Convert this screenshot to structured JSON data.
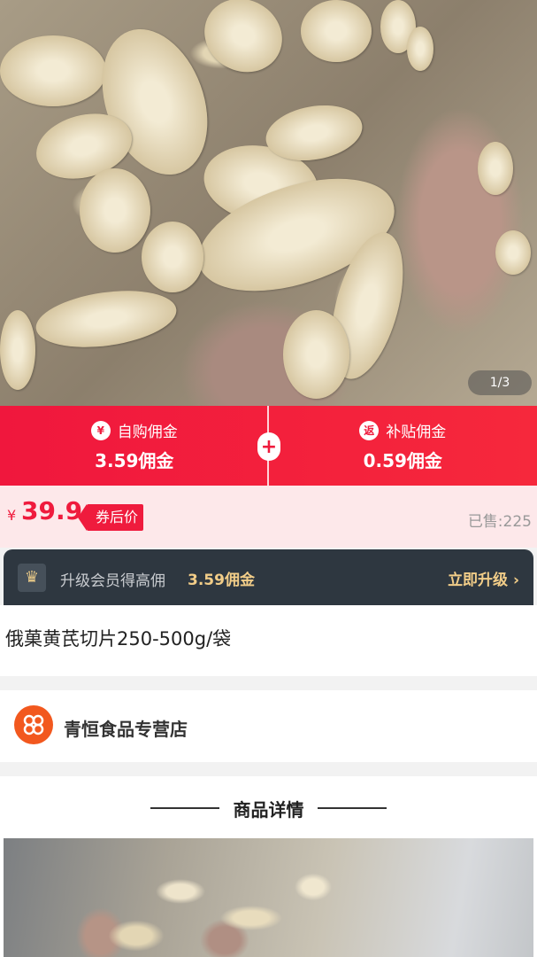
{
  "gallery": {
    "counter": "1/3"
  },
  "commission": {
    "self_buy": {
      "icon": "¥",
      "label": "自购佣金",
      "value": "3.59佣金"
    },
    "plus": "+",
    "subsidy": {
      "icon": "返",
      "label": "补贴佣金",
      "value": "0.59佣金"
    }
  },
  "price": {
    "currency": "¥",
    "amount": "39.9",
    "tag": "券后价",
    "sold": "已售:225"
  },
  "vip": {
    "text": "升级会员得高佣",
    "amount": "3.59佣金",
    "action": "立即升级 ›"
  },
  "product": {
    "title": "俄菓黄芪切片250-500g/袋"
  },
  "store": {
    "name": "青恒食品专营店"
  },
  "details": {
    "heading": "商品详情"
  },
  "colors": {
    "accent": "#ef1b3d",
    "vip_bg": "#2e3740",
    "vip_gold": "#f2cd88"
  }
}
